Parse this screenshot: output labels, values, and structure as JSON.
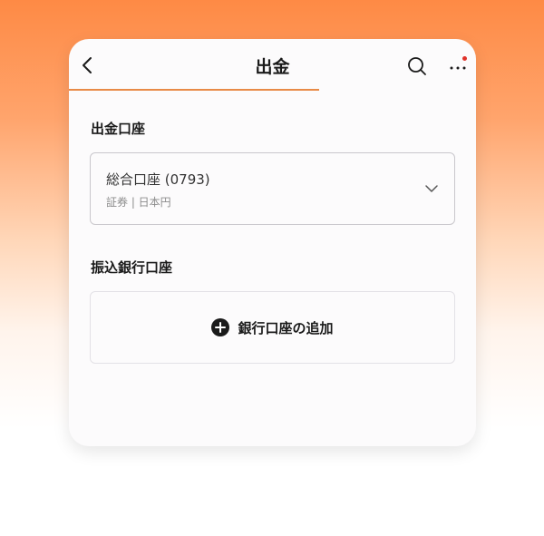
{
  "header": {
    "title": "出金",
    "back_icon": "chevron-left-icon",
    "search_icon": "search-icon",
    "more_icon": "more-dots-icon",
    "accent_color": "#e88a46",
    "badge_color": "#e0322a"
  },
  "withdrawal_account": {
    "label": "出金口座",
    "selected_name": "総合口座 (0793)",
    "selected_sub": "証券 | 日本円"
  },
  "bank_account": {
    "label": "振込銀行口座",
    "add_label": "銀行口座の追加"
  }
}
